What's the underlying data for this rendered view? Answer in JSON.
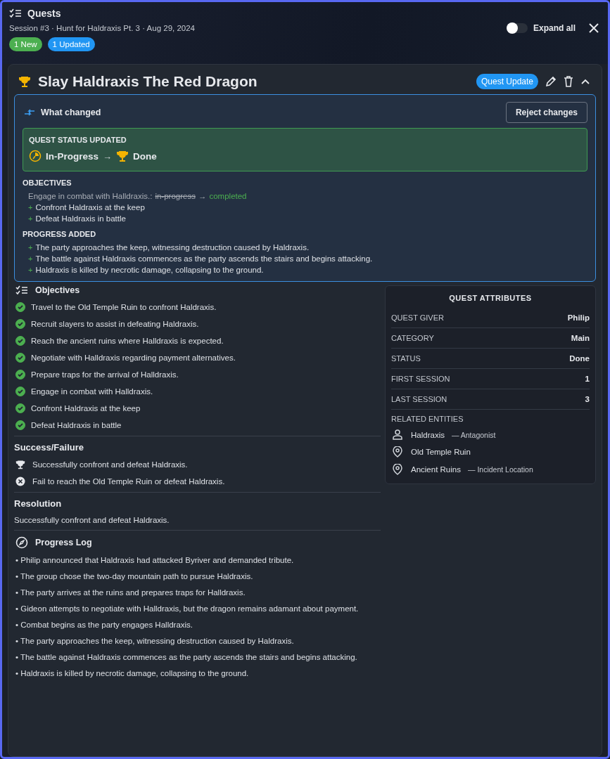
{
  "header": {
    "title": "Quests",
    "subtitle": "Session #3 · Hunt for Haldraxis Pt. 3 · Aug 29, 2024",
    "badges": [
      {
        "label": "1 New",
        "color": "#4caf50"
      },
      {
        "label": "1 Updated",
        "color": "#2196f3"
      }
    ],
    "expand_all": {
      "label": "Expand all",
      "on": false
    }
  },
  "quest": {
    "title": "Slay Haldraxis The Red Dragon",
    "badge": "Quest Update",
    "expanded": true,
    "changes": {
      "title": "What changed",
      "reject_button": "Reject changes",
      "status": {
        "heading": "QUEST STATUS UPDATED",
        "from": "In-Progress",
        "arrow": "→",
        "to": "Done"
      },
      "objectives_heading": "OBJECTIVES",
      "objective_changes": [
        {
          "kind": "changed",
          "text": "Engage in combat with Halldraxis.:",
          "old": "in-progress",
          "arrow": "→",
          "new": "completed"
        },
        {
          "kind": "added",
          "marker": "+",
          "text": "Confront Haldraxis at the keep"
        },
        {
          "kind": "added",
          "marker": "+",
          "text": "Defeat Haldraxis in battle"
        }
      ],
      "progress_heading": "PROGRESS ADDED",
      "progress_added": [
        {
          "marker": "+",
          "text": "The party approaches the keep, witnessing destruction caused by Haldraxis."
        },
        {
          "marker": "+",
          "text": "The battle against Haldraxis commences as the party ascends the stairs and begins attacking."
        },
        {
          "marker": "+",
          "text": "Haldraxis is killed by necrotic damage, collapsing to the ground."
        }
      ]
    },
    "objectives": {
      "title": "Objectives",
      "items": [
        {
          "text": "Travel to the Old Temple Ruin to confront Haldraxis.",
          "checked": true
        },
        {
          "text": "Recruit slayers to assist in defeating Haldraxis.",
          "checked": true
        },
        {
          "text": "Reach the ancient ruins where Halldraxis is expected.",
          "checked": true
        },
        {
          "text": "Negotiate with Halldraxis regarding payment alternatives.",
          "checked": true
        },
        {
          "text": "Prepare traps for the arrival of Halldraxis.",
          "checked": true
        },
        {
          "text": "Engage in combat with Halldraxis.",
          "checked": true
        },
        {
          "text": "Confront Haldraxis at the keep",
          "checked": true
        },
        {
          "text": "Defeat Haldraxis in battle",
          "checked": true
        }
      ]
    },
    "success_failure": {
      "title": "Success/Failure",
      "items": [
        {
          "kind": "success",
          "text": "Successfully confront and defeat Haldraxis."
        },
        {
          "kind": "failure",
          "text": "Fail to reach the Old Temple Ruin or defeat Haldraxis."
        }
      ]
    },
    "resolution": {
      "title": "Resolution",
      "text": "Successfully confront and defeat Haldraxis."
    },
    "progress_log": {
      "title": "Progress Log",
      "items": [
        "• Philip announced that Haldraxis had attacked Byriver and demanded tribute.",
        "• The group chose the two-day mountain path to pursue Haldraxis.",
        "• The party arrives at the ruins and prepares traps for Halldraxis.",
        "• Gideon attempts to negotiate with Halldraxis, but the dragon remains adamant about payment.",
        "• Combat begins as the party engages Halldraxis.",
        "• The party approaches the keep, witnessing destruction caused by Haldraxis.",
        "• The battle against Haldraxis commences as the party ascends the stairs and begins attacking.",
        "• Haldraxis is killed by necrotic damage, collapsing to the ground."
      ]
    },
    "attributes": {
      "title": "QUEST ATTRIBUTES",
      "rows": [
        {
          "label": "QUEST GIVER",
          "value": "Philip"
        },
        {
          "label": "CATEGORY",
          "value": "Main"
        },
        {
          "label": "STATUS",
          "value": "Done"
        },
        {
          "label": "FIRST SESSION",
          "value": "1"
        },
        {
          "label": "LAST SESSION",
          "value": "3"
        }
      ],
      "related_heading": "RELATED ENTITIES",
      "related": [
        {
          "kind": "person",
          "name": "Haldraxis",
          "role": "— Antagonist"
        },
        {
          "kind": "place",
          "name": "Old Temple Ruin"
        },
        {
          "kind": "place",
          "name": "Ancient Ruins",
          "role": "— Incident Location"
        }
      ]
    }
  }
}
